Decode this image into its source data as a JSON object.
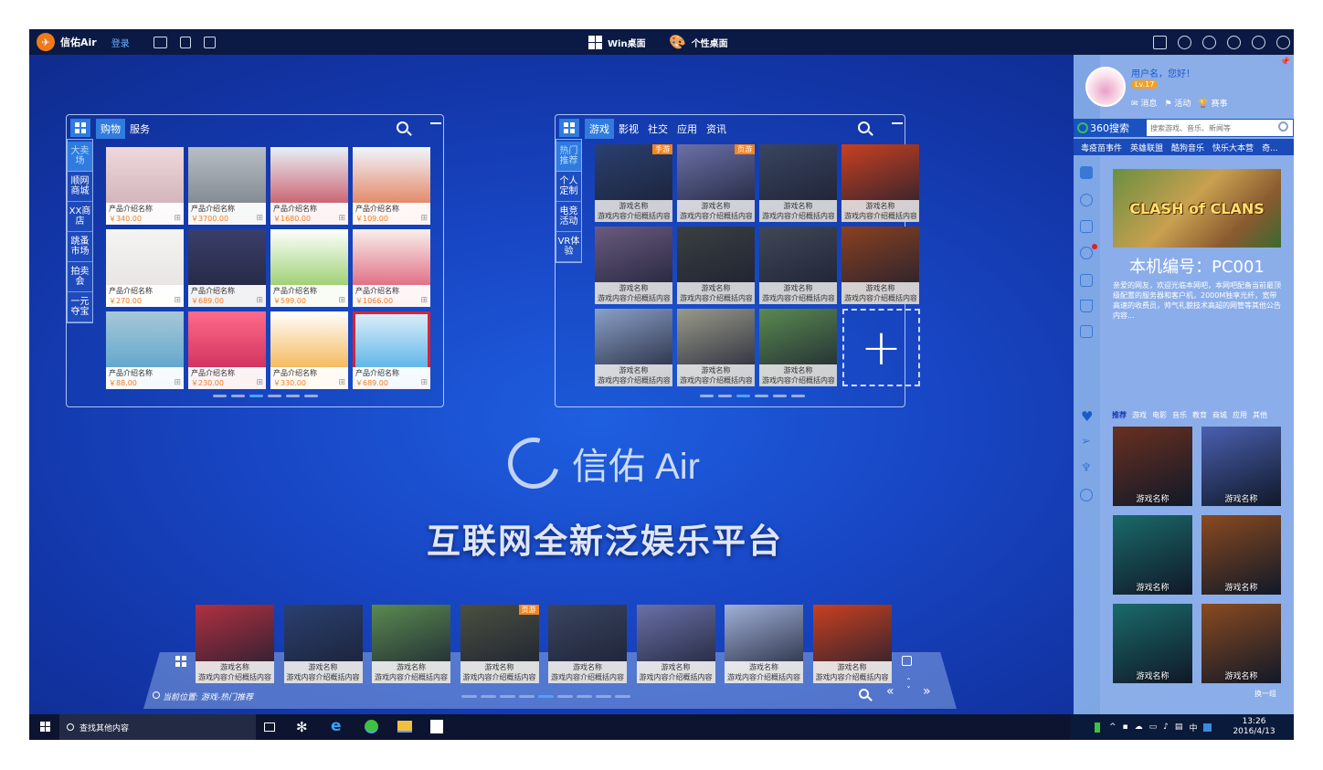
{
  "topbar": {
    "app_name": "信佑Air",
    "login": "登录",
    "win_desktop": "Win桌面",
    "personal_desktop": "个性桌面"
  },
  "shop_panel": {
    "tabs": [
      "购物",
      "服务"
    ],
    "side_tabs": [
      "大卖场",
      "顺网商城",
      "XX商店",
      "跳蚤市场",
      "拍卖会",
      "一元夺宝"
    ],
    "products": [
      {
        "name": "产品介绍名称",
        "price": "￥340.00"
      },
      {
        "name": "产品介绍名称",
        "price": "￥3700.00"
      },
      {
        "name": "产品介绍名称",
        "price": "￥1680.00"
      },
      {
        "name": "产品介绍名称",
        "price": "￥109.00"
      },
      {
        "name": "产品介绍名称",
        "price": "￥270.00"
      },
      {
        "name": "产品介绍名称",
        "price": "￥689.00"
      },
      {
        "name": "产品介绍名称",
        "price": "￥599.00"
      },
      {
        "name": "产品介绍名称",
        "price": "￥1066.00"
      },
      {
        "name": "产品介绍名称",
        "price": "￥88.00"
      },
      {
        "name": "产品介绍名称",
        "price": "￥230.00"
      },
      {
        "name": "产品介绍名称",
        "price": "￥330.00"
      },
      {
        "name": "产品介绍名称",
        "price": "￥689.00"
      }
    ]
  },
  "game_panel": {
    "tabs": [
      "游戏",
      "影视",
      "社交",
      "应用",
      "资讯"
    ],
    "side_tabs": [
      "热门推荐",
      "个人定制",
      "电竞活动",
      "VR体验"
    ],
    "tags": [
      "手游",
      "页游"
    ],
    "game_name": "游戏名称",
    "game_desc": "游戏内容介绍概括内容..."
  },
  "center": {
    "brand": "信佑 Air",
    "slogan": "互联网全新泛娱乐平台"
  },
  "dock": {
    "location": "当前位置: 游戏-热门推荐",
    "tag": "页游",
    "game_name": "游戏名称",
    "game_desc": "游戏内容介绍概括内容..."
  },
  "right": {
    "greeting": "用户名，您好！",
    "level": "Lv.17",
    "links": [
      "消息",
      "活动",
      "赛事"
    ],
    "search_brand": "360搜索",
    "search_placeholder": "搜索游戏、音乐、新闻等",
    "hot": [
      "毒疫苗事件",
      "英雄联盟",
      "酷狗音乐",
      "快乐大本营",
      "奇..."
    ],
    "banner_title": "CLASH of CLANS",
    "machine_id": "本机编号：PC001",
    "notice": "亲爱的网友，欢迎光临本网吧，本网吧配备当前最顶级配置的服务器和客户机，2000M独享光纤，宽带高速的收费员，帅气礼貌技术高超的网管等其他公告内容...",
    "cats": [
      "推荐",
      "游戏",
      "电影",
      "音乐",
      "教育",
      "商城",
      "应用",
      "其他"
    ],
    "game_name": "游戏名称",
    "swap": "换一组"
  },
  "taskbar": {
    "search": "查找其他内容",
    "ime": "中",
    "time": "13:26",
    "date": "2016/4/13"
  }
}
